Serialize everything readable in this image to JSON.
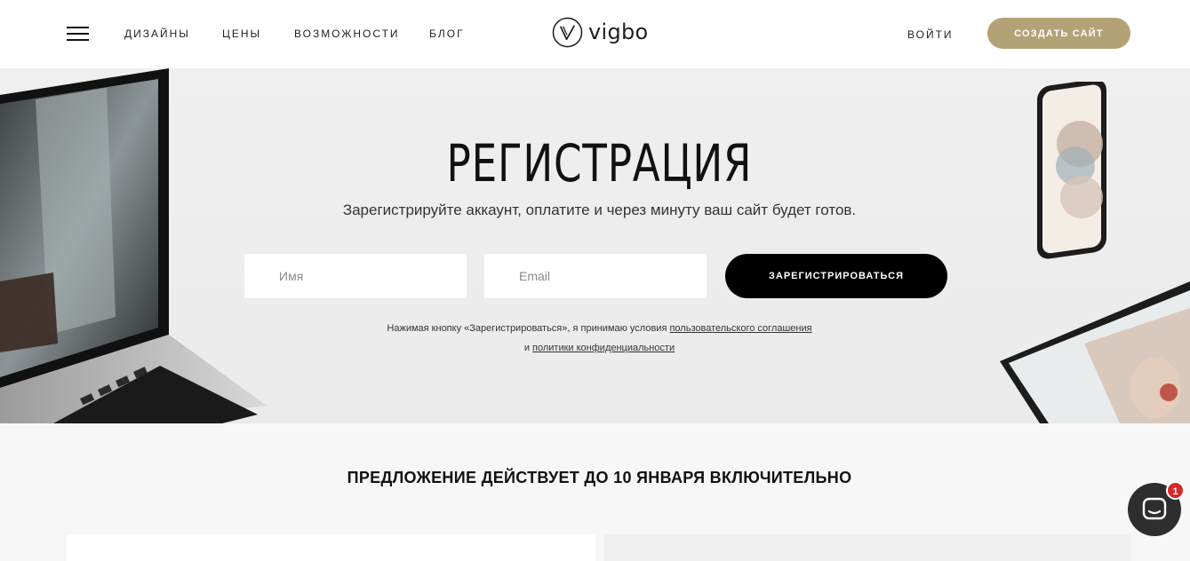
{
  "header": {
    "nav": [
      {
        "label": "ДИЗАЙНЫ"
      },
      {
        "label": "ЦЕНЫ"
      },
      {
        "label": "ВОЗМОЖНОСТИ"
      },
      {
        "label": "БЛОГ"
      }
    ],
    "logo_text": "vigbo",
    "login_label": "ВОЙТИ",
    "create_site_label": "СОЗДАТЬ САЙТ"
  },
  "hero": {
    "title": "РЕГИСТРАЦИЯ",
    "subtitle": "Зарегистрируйте аккаунт, оплатите и через минуту ваш сайт будет готов.",
    "name_placeholder": "Имя",
    "email_placeholder": "Email",
    "register_label": "ЗАРЕГИСТРИРОВАТЬСЯ",
    "terms_prefix": "Нажимая кнопку «Зарегистрироваться», я принимаю условия ",
    "terms_link": "пользовательского соглашения",
    "privacy_prefix": "и ",
    "privacy_link": "политики конфиденциальности"
  },
  "offer": {
    "text": "ПРЕДЛОЖЕНИЕ ДЕЙСТВУЕТ ДО 10 ЯНВАРЯ ВКЛЮЧИТЕЛЬНО"
  },
  "chat": {
    "badge_count": "1"
  },
  "colors": {
    "accent_gold": "#b4a277",
    "button_black": "#000000",
    "badge_red": "#d62828"
  }
}
